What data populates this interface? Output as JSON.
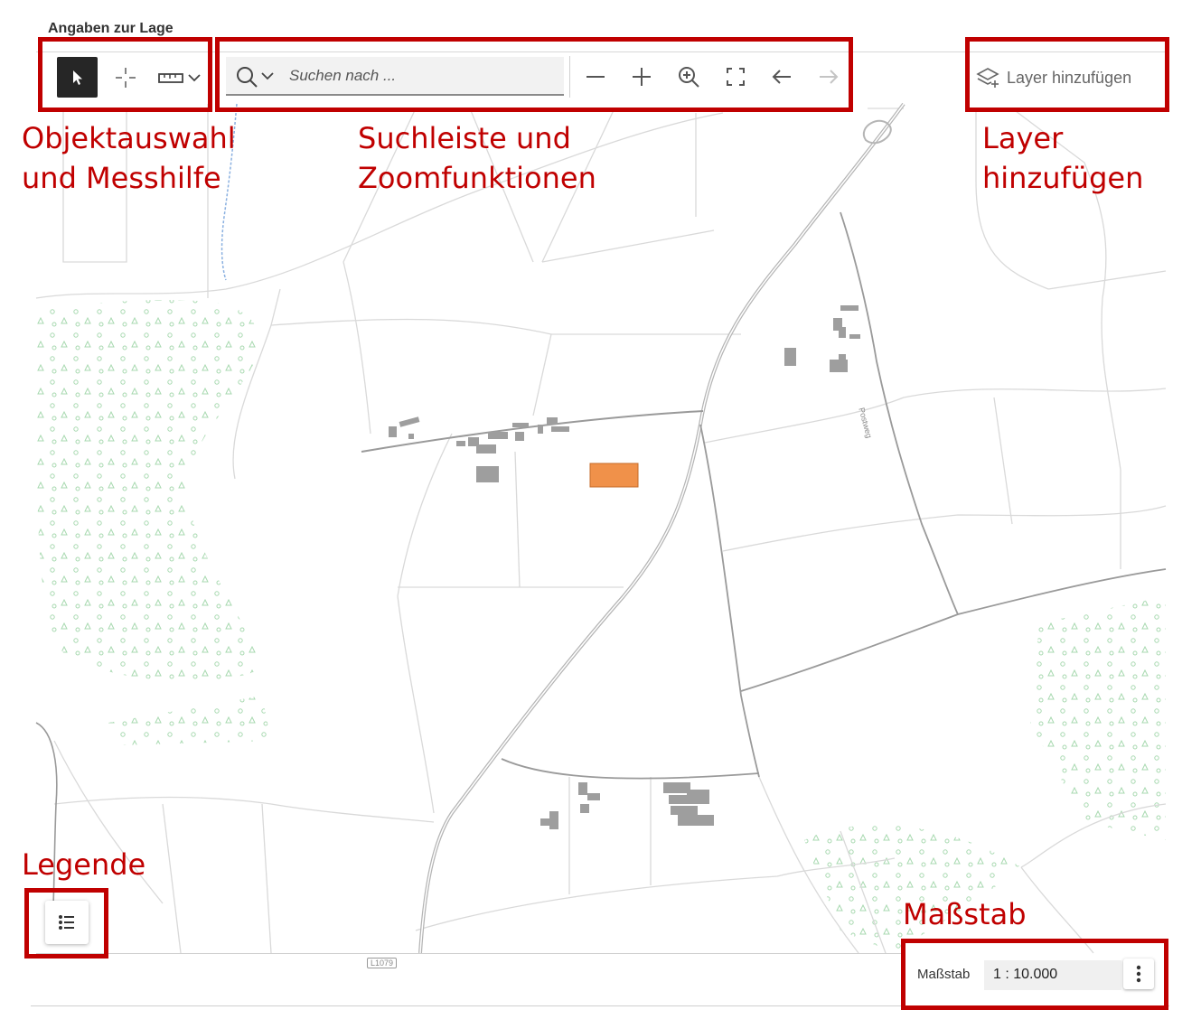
{
  "header": {
    "title": "Angaben zur Lage"
  },
  "toolbar": {
    "select_tool_icon": "cursor-arrow-icon",
    "point_tool_icon": "crosshair-icon",
    "measure_tool_icon": "ruler-icon",
    "search": {
      "placeholder": "Suchen nach ..."
    },
    "zoom_buttons": [
      "zoom-out-icon",
      "zoom-in-icon",
      "zoom-to-selection-icon",
      "fullscreen-extent-icon",
      "back-icon",
      "forward-icon"
    ],
    "layer_button_label": "Layer hinzufügen"
  },
  "annotations": {
    "objektauswahl": "Objektauswahl\nund Messhilfe",
    "suchleiste": "Suchleiste und\nZoomfunktionen",
    "layer": "Layer\nhinzufügen",
    "legende": "Legende",
    "massstab": "Maßstab"
  },
  "map": {
    "street_label": "Postweg",
    "road_shield": "L1079",
    "colors": {
      "highlight_parcel": "#f0914a",
      "buildings": "#9e9e9e",
      "forest_symbols": "#9fd3a8",
      "roads": "#bdbdbd",
      "water": "#8ab0e0"
    }
  },
  "scale": {
    "label": "Maßstab",
    "value": "1 : 10.000"
  },
  "colors": {
    "annotation_red": "#c00000",
    "select_button_bg": "#262626"
  }
}
